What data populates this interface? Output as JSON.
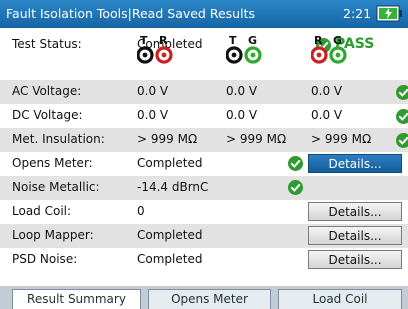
{
  "titlebar": {
    "title": "Fault Isolation Tools|Read Saved Results",
    "time": "2:21"
  },
  "status": {
    "label": "Test Status:",
    "value": "Completed",
    "result": "PASS"
  },
  "pairs": [
    {
      "a": "T",
      "b": "R",
      "a_color": "#111111",
      "b_color": "#cc1f1f"
    },
    {
      "a": "T",
      "b": "G",
      "a_color": "#111111",
      "b_color": "#2ea82e"
    },
    {
      "a": "R",
      "b": "G",
      "a_color": "#cc1f1f",
      "b_color": "#2ea82e"
    }
  ],
  "rows": {
    "ac_voltage": {
      "label": "AC Voltage:",
      "v1": "0.0 V",
      "v2": "0.0 V",
      "v3": "0.0 V"
    },
    "dc_voltage": {
      "label": "DC Voltage:",
      "v1": "0.0 V",
      "v2": "0.0 V",
      "v3": "0.0 V"
    },
    "met_insulation": {
      "label": "Met. Insulation:",
      "v1": "> 999 MΩ",
      "v2": "> 999 MΩ",
      "v3": "> 999 MΩ"
    },
    "opens_meter": {
      "label": "Opens Meter:",
      "value": "Completed",
      "button": "Details..."
    },
    "noise_metallic": {
      "label": "Noise Metallic:",
      "value": "-14.4 dBrnC"
    },
    "load_coil": {
      "label": "Load Coil:",
      "value": "0",
      "button": "Details..."
    },
    "loop_mapper": {
      "label": "Loop Mapper:",
      "value": "Completed",
      "button": "Details..."
    },
    "psd_noise": {
      "label": "PSD Noise:",
      "value": "Completed",
      "button": "Details..."
    }
  },
  "tabs": [
    "Result Summary",
    "Opens Meter",
    "Load Coil"
  ],
  "colors": {
    "pass_green": "#2f9a2f",
    "title_blue": "#1a6fb3",
    "selected_blue": "#1c6aa9"
  }
}
